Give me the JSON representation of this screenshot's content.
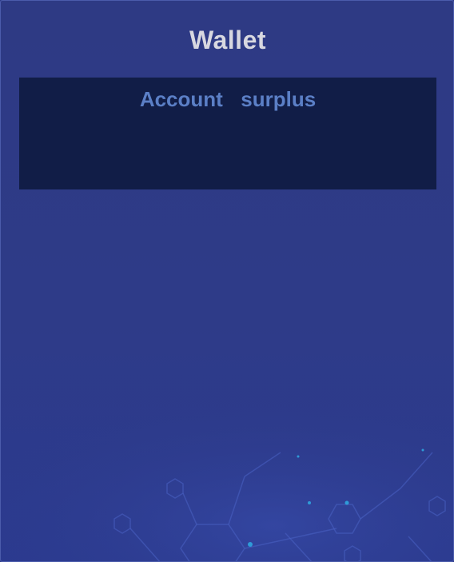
{
  "wallet": {
    "title": "Wallet",
    "account_surplus_label": "Account  surplus"
  },
  "colors": {
    "background": "#2e3a84",
    "title_text": "#d8d8e0",
    "surplus_box": "#111d47",
    "surplus_label": "#5b7fc6",
    "network_glow": "#2f9bd8"
  }
}
